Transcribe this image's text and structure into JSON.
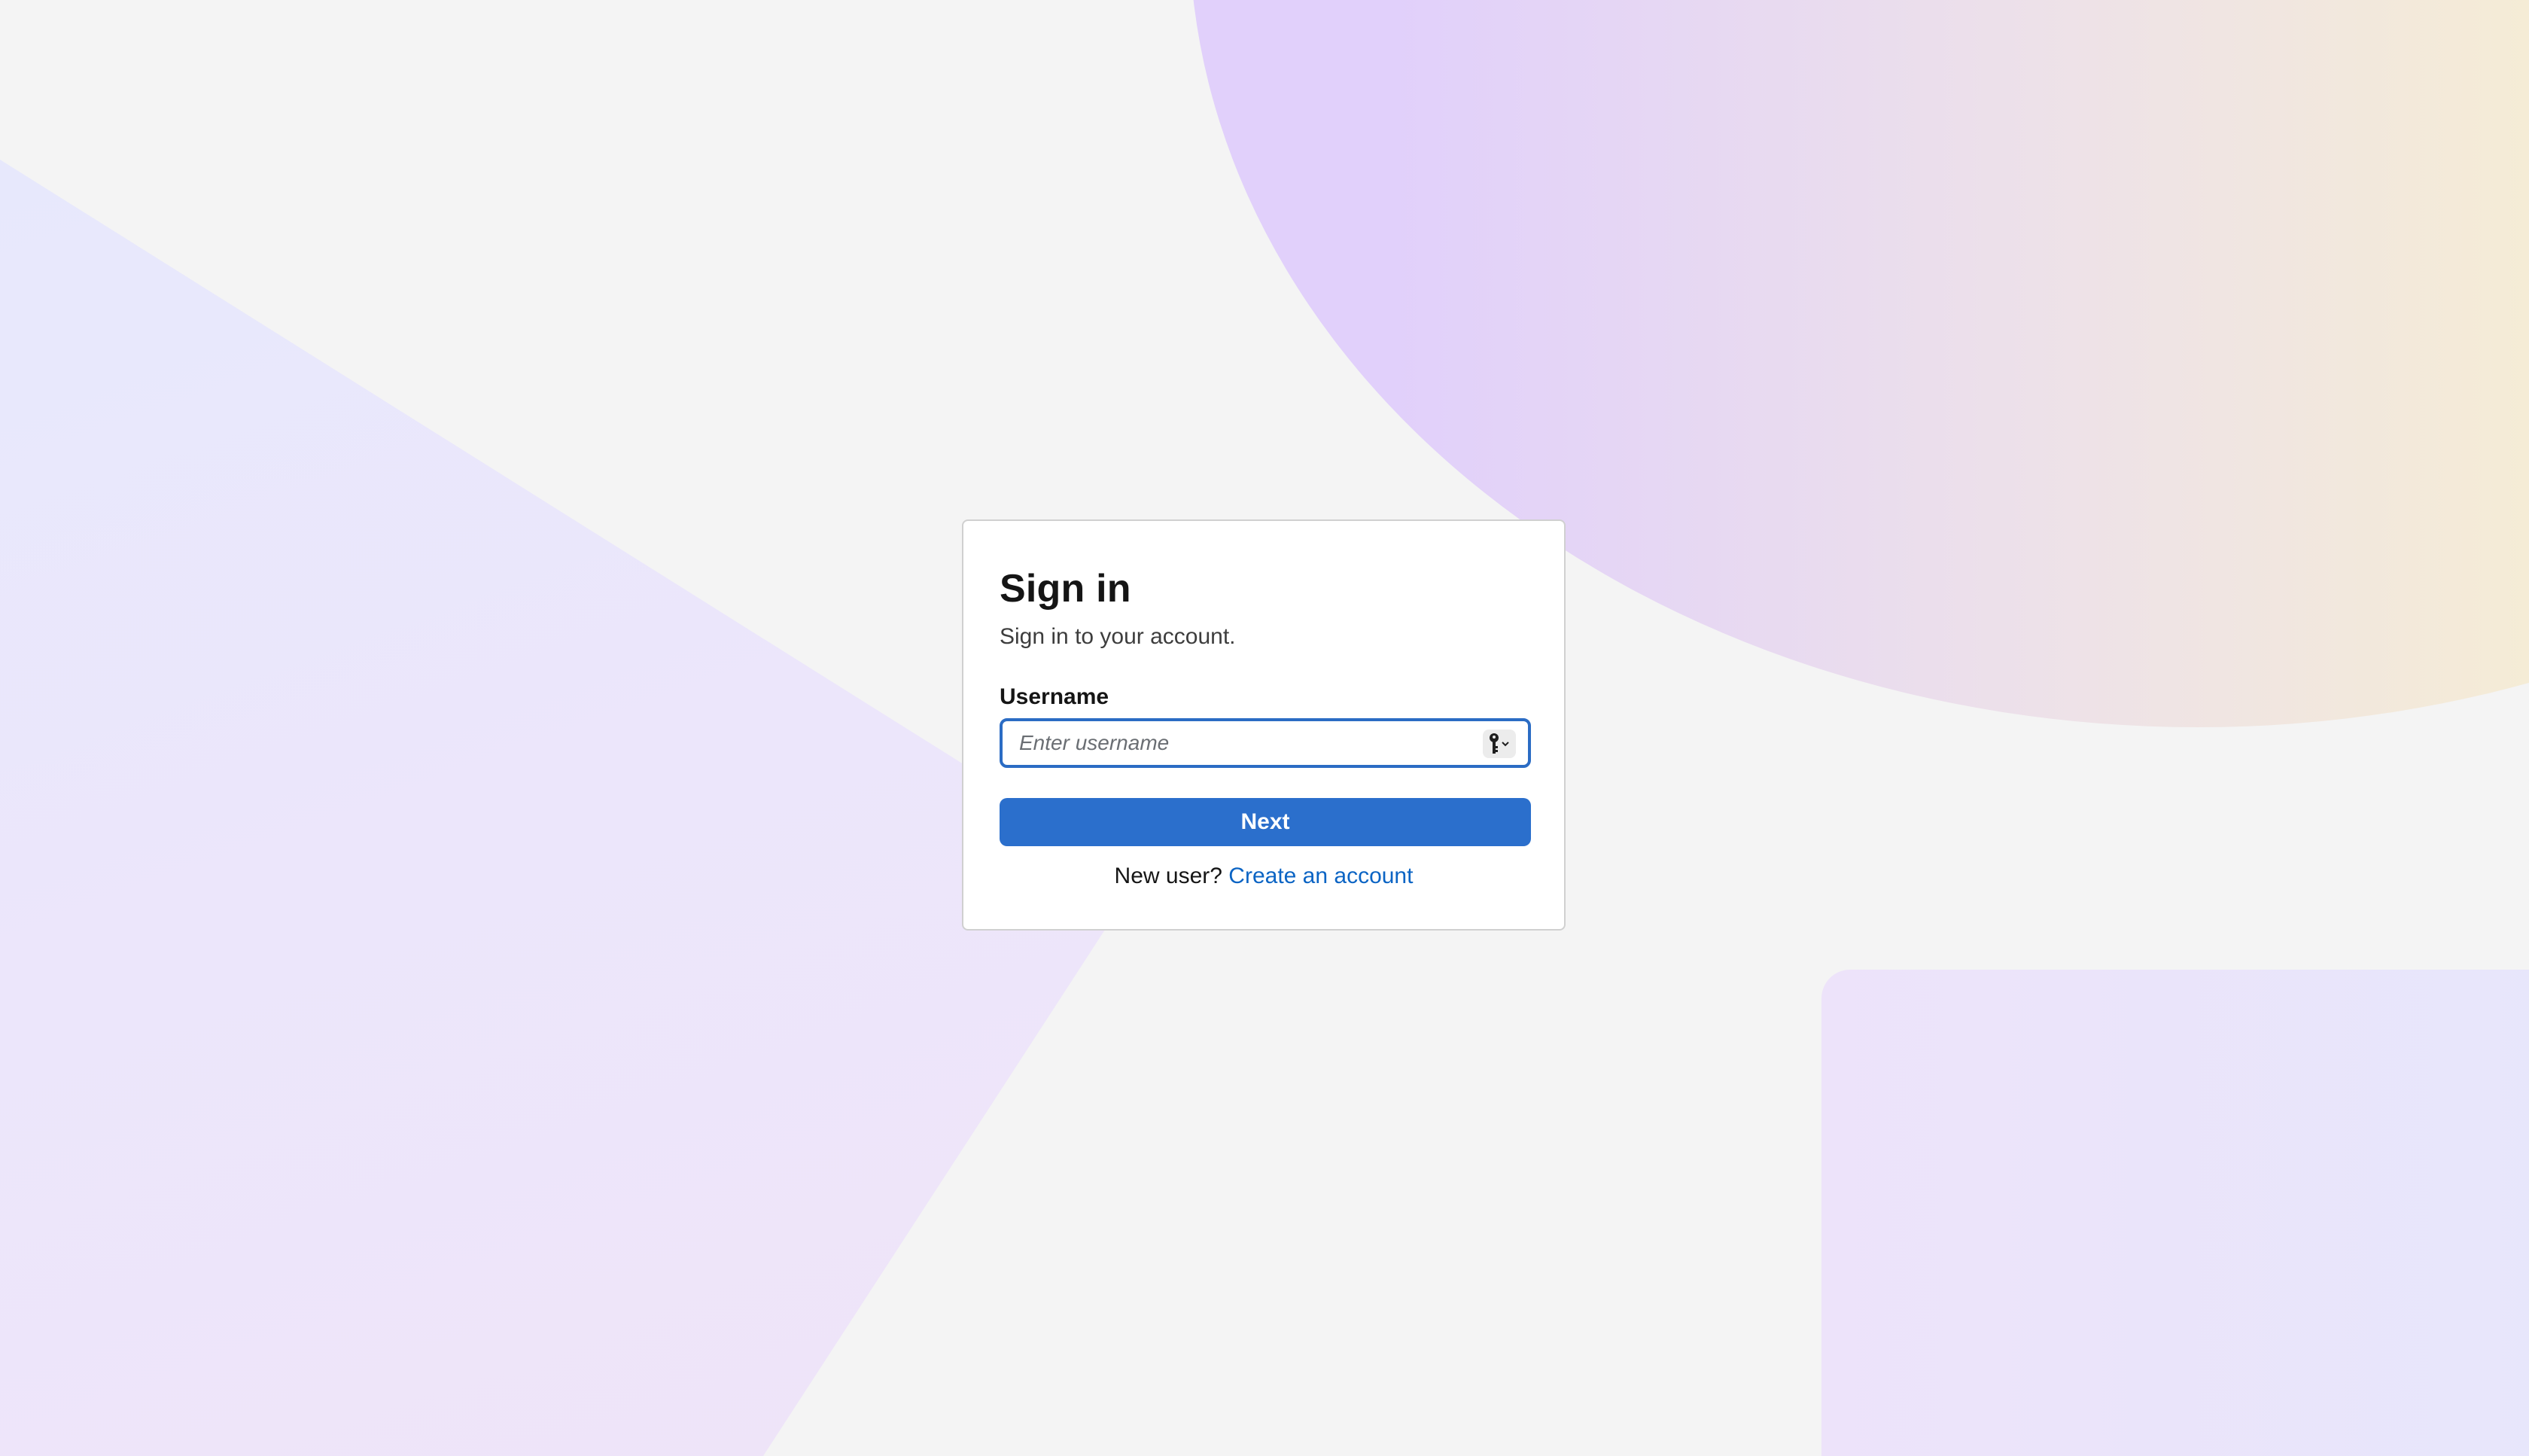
{
  "login": {
    "title": "Sign in",
    "subtitle": "Sign in to your account.",
    "username_label": "Username",
    "username_value": "",
    "username_placeholder": "Enter username",
    "next_label": "Next",
    "new_user_prompt": "New user?",
    "create_account_link": "Create an account"
  },
  "icons": {
    "password_manager": "key-icon"
  },
  "colors": {
    "primary": "#2b6fcc",
    "link": "#0b64c4",
    "background": "#f4f4f4",
    "focus_border": "#2b6cc4"
  }
}
